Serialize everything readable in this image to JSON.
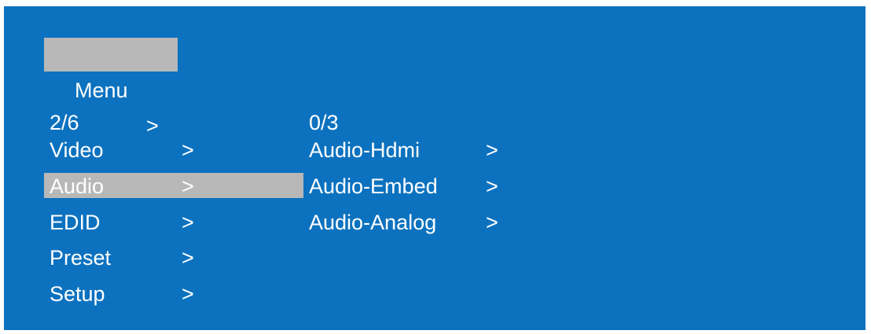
{
  "header": {
    "title": "Menu",
    "arrow": ">"
  },
  "main_menu": {
    "counter": "2/6",
    "items": [
      {
        "label": "Video",
        "arrow": ">"
      },
      {
        "label": "Audio",
        "arrow": ">"
      },
      {
        "label": "EDID",
        "arrow": ">"
      },
      {
        "label": "Preset",
        "arrow": ">"
      },
      {
        "label": "Setup",
        "arrow": ">"
      }
    ]
  },
  "sub_menu": {
    "counter": "0/3",
    "items": [
      {
        "label": "Audio-Hdmi",
        "arrow": ">"
      },
      {
        "label": "Audio-Embed",
        "arrow": ">"
      },
      {
        "label": "Audio-Analog",
        "arrow": ">"
      }
    ]
  },
  "colors": {
    "background": "#0c72bf",
    "highlight": "#b8b8b8",
    "text": "#ffffff"
  }
}
